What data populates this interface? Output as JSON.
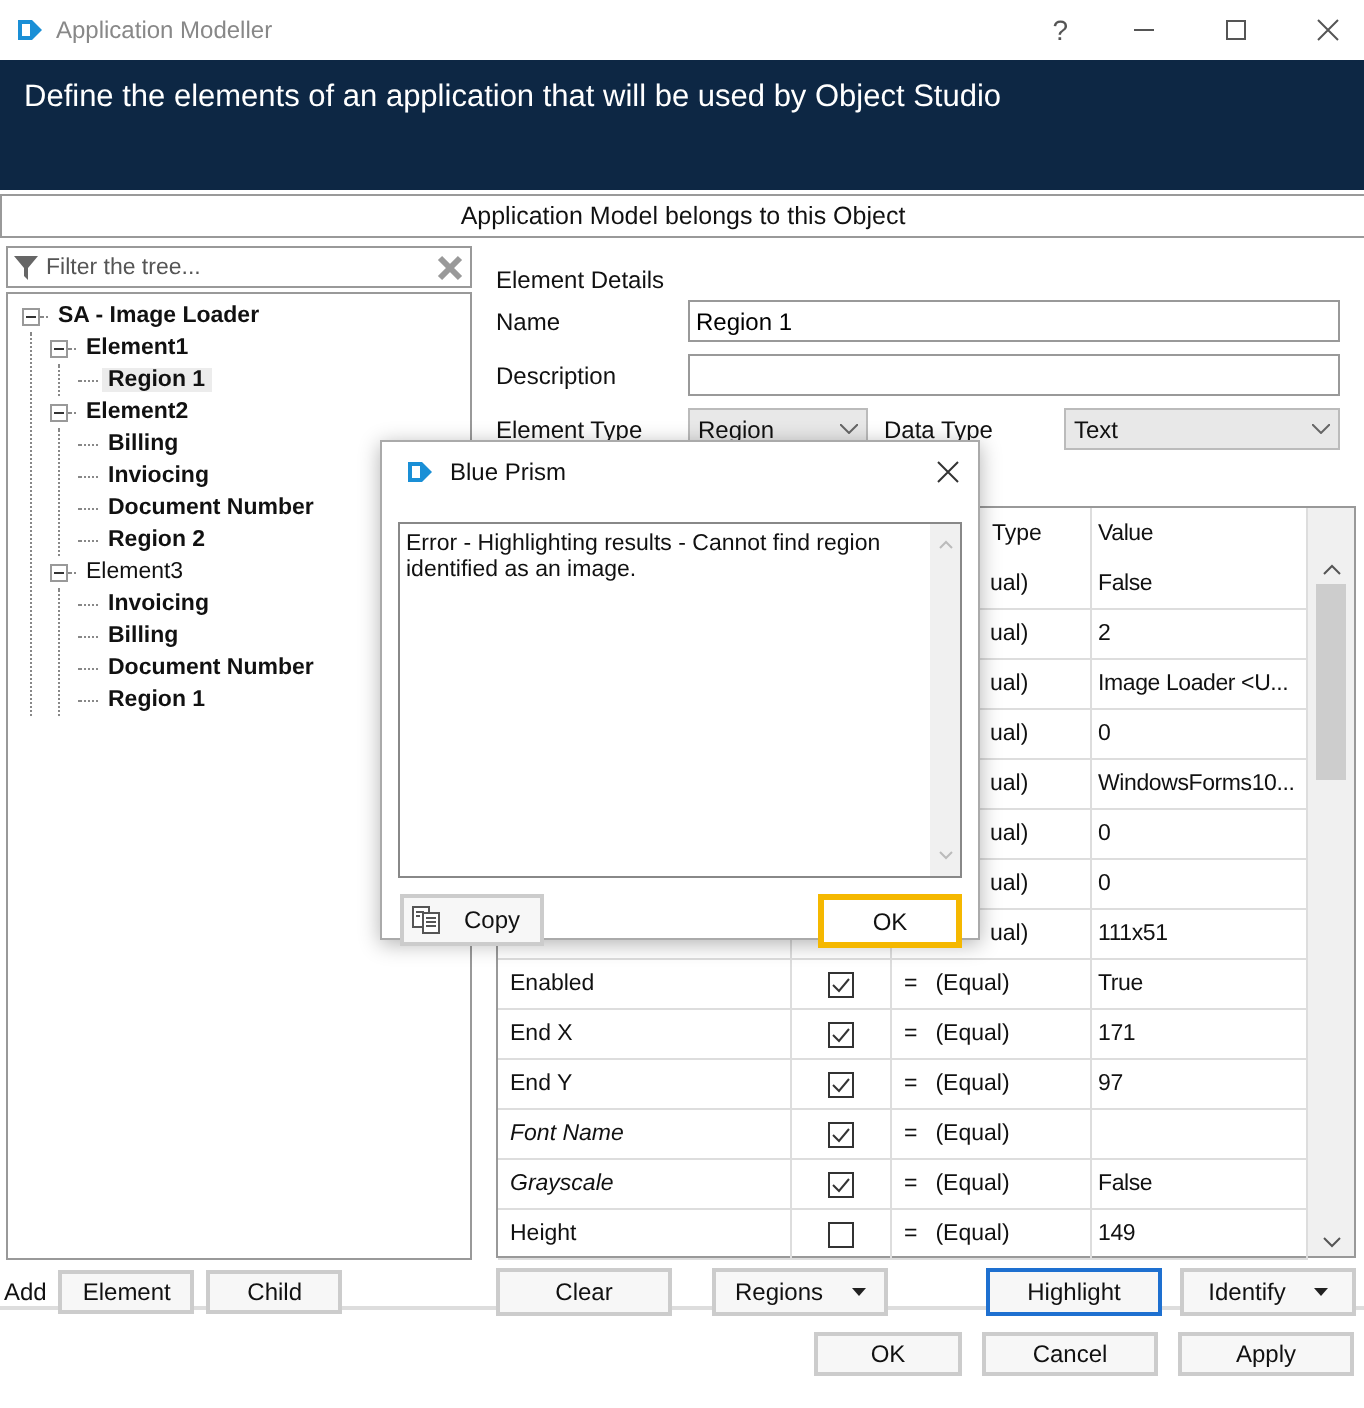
{
  "window": {
    "title": "Application Modeller",
    "help": "?"
  },
  "banner": "Define the elements of an application that will be used by Object Studio",
  "object_bar": "Application Model belongs to this Object",
  "filter": {
    "placeholder": "Filter the tree..."
  },
  "tree": [
    {
      "label": "SA -  Image Loader",
      "bold": true,
      "selected": false,
      "expanded": true,
      "children": [
        {
          "label": "Element1",
          "bold": true,
          "selected": false,
          "expanded": true,
          "children": [
            {
              "label": "Region 1",
              "bold": true,
              "selected": true
            }
          ]
        },
        {
          "label": "Element2",
          "bold": true,
          "selected": false,
          "expanded": true,
          "children": [
            {
              "label": "Billing",
              "bold": true,
              "selected": false
            },
            {
              "label": "Inviocing",
              "bold": true,
              "selected": false
            },
            {
              "label": "Document Number",
              "bold": true,
              "selected": false
            },
            {
              "label": "Region 2",
              "bold": true,
              "selected": false
            }
          ]
        },
        {
          "label": "Element3",
          "bold": false,
          "selected": false,
          "expanded": true,
          "children": [
            {
              "label": "Invoicing",
              "bold": true,
              "selected": false
            },
            {
              "label": "Billing",
              "bold": true,
              "selected": false
            },
            {
              "label": "Document Number",
              "bold": true,
              "selected": false
            },
            {
              "label": "Region 1",
              "bold": true,
              "selected": false
            }
          ]
        }
      ]
    }
  ],
  "add": {
    "label": "Add",
    "buttons": [
      "Element",
      "Child"
    ]
  },
  "details": {
    "title": "Element Details",
    "name_label": "Name",
    "name_value": "Region 1",
    "description_label": "Description",
    "type_label": "Element Type",
    "type_value": "Region",
    "data_type_label": "Data Type",
    "data_type_value": "Text"
  },
  "grid": {
    "columns": [
      "Type",
      "Value"
    ],
    "rows": [
      {
        "match": "ual)",
        "value": "False"
      },
      {
        "match": "ual)",
        "value": "2"
      },
      {
        "match": "ual)",
        "value": "Image Loader <U..."
      },
      {
        "match": "ual)",
        "value": "0"
      },
      {
        "match": "ual)",
        "value": "WindowsForms10..."
      },
      {
        "match": "ual)",
        "value": "0"
      },
      {
        "match": "ual)",
        "value": "0"
      },
      {
        "match": "ual)",
        "value": "111x51"
      },
      {
        "name": "Enabled",
        "italic": false,
        "checked": true,
        "operator": "=",
        "match": "(Equal)",
        "value": "True"
      },
      {
        "name": "End X",
        "italic": false,
        "checked": true,
        "operator": "=",
        "match": "(Equal)",
        "value": "171"
      },
      {
        "name": "End Y",
        "italic": false,
        "checked": true,
        "operator": "=",
        "match": "(Equal)",
        "value": "97"
      },
      {
        "name": "Font Name",
        "italic": true,
        "checked": true,
        "operator": "=",
        "match": "(Equal)"
      },
      {
        "name": "Grayscale",
        "italic": true,
        "checked": true,
        "operator": "=",
        "match": "(Equal)",
        "value": "False"
      },
      {
        "name": "Height",
        "italic": false,
        "checked": false,
        "operator": "=",
        "match": "(Equal)",
        "value": "149"
      }
    ]
  },
  "grid_buttons": [
    {
      "label": "Clear",
      "dropdown": false,
      "selected": false
    },
    {
      "label": "Regions",
      "dropdown": true,
      "selected": false
    },
    {
      "label": "Highlight",
      "dropdown": false,
      "selected": true
    },
    {
      "label": "Identify",
      "dropdown": true,
      "selected": false
    }
  ],
  "footer_buttons": [
    "OK",
    "Cancel",
    "Apply"
  ],
  "dialog": {
    "title": "Blue Prism",
    "message": "Error - Highlighting results - Cannot find region identified as an image.",
    "copy": "Copy",
    "ok": "OK"
  }
}
